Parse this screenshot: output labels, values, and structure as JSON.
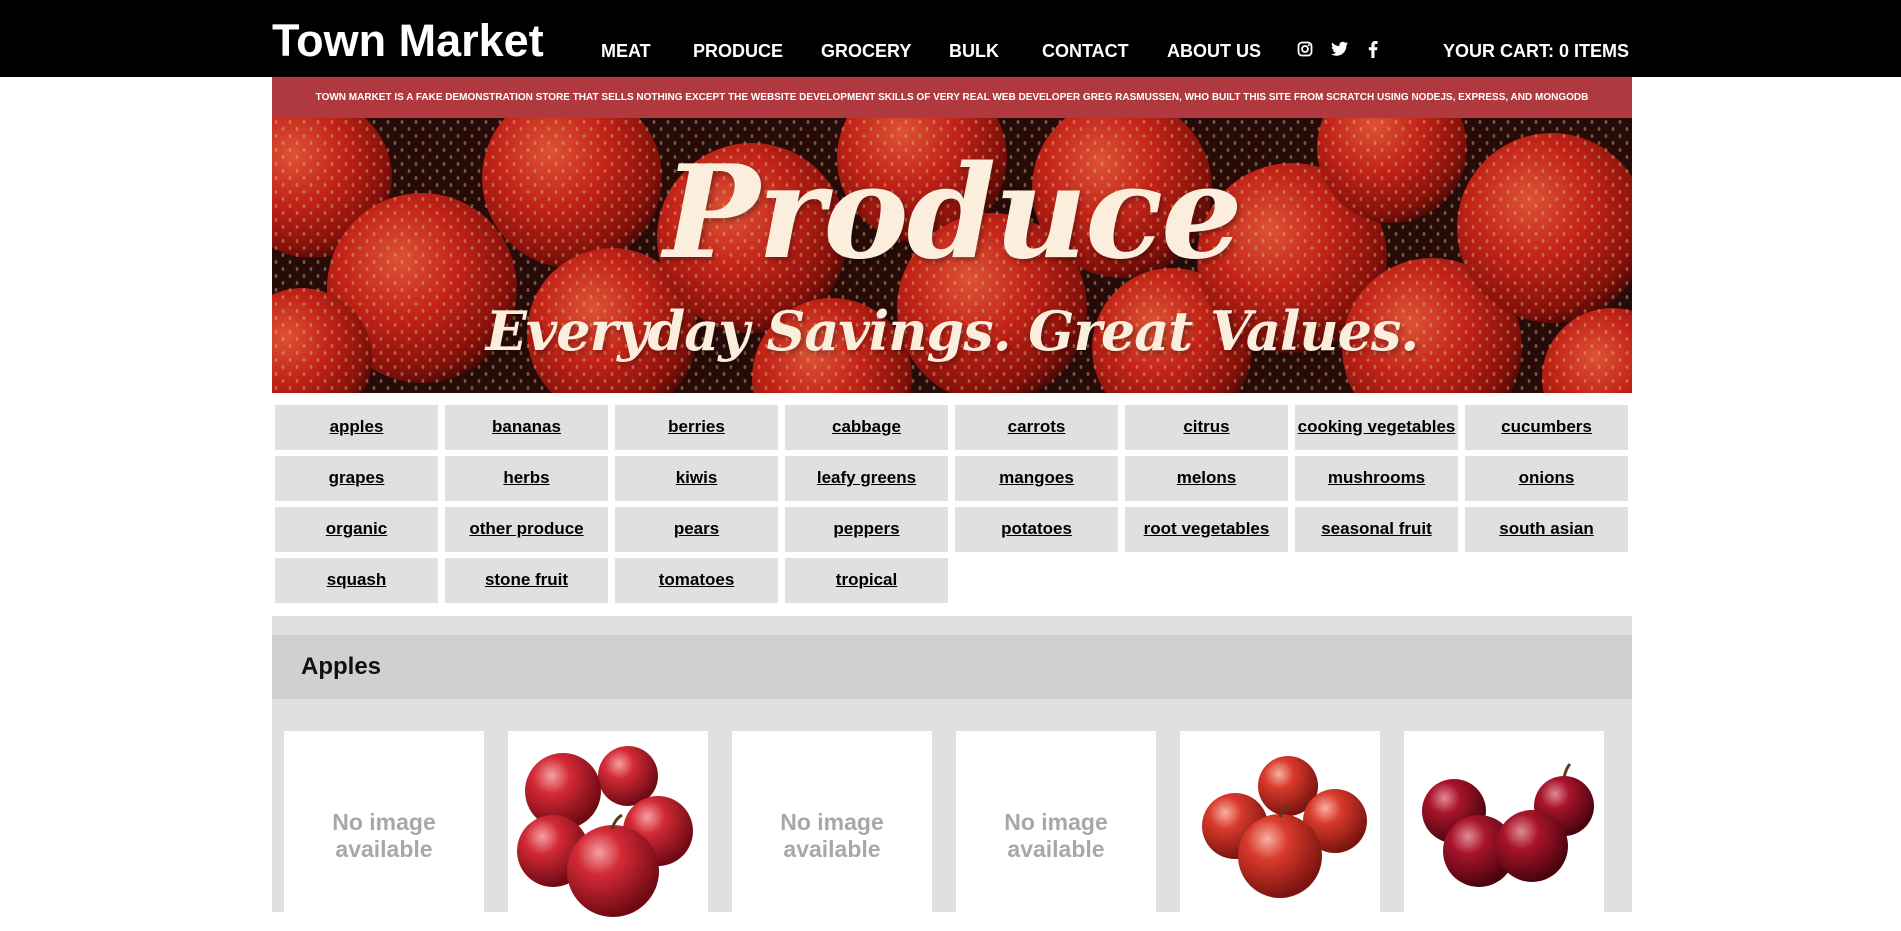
{
  "header": {
    "logo": "Town Market",
    "nav": [
      "MEAT",
      "PRODUCE",
      "GROCERY",
      "BULK",
      "CONTACT",
      "ABOUT US"
    ],
    "social_icons": [
      "instagram-icon",
      "twitter-icon",
      "facebook-icon"
    ],
    "cart": "YOUR CART: 0 ITEMS"
  },
  "notice": "TOWN MARKET IS A FAKE DEMONSTRATION STORE THAT SELLS NOTHING EXCEPT THE WEBSITE DEVELOPMENT SKILLS OF VERY REAL WEB DEVELOPER GREG RASMUSSEN, WHO BUILT THIS SITE FROM SCRATCH USING NODEJS, EXPRESS, AND MONGODB",
  "hero": {
    "title": "Produce",
    "subtitle": "Everyday Savings. Great Values."
  },
  "categories": [
    "apples",
    "bananas",
    "berries",
    "cabbage",
    "carrots",
    "citrus",
    "cooking vegetables",
    "cucumbers",
    "grapes",
    "herbs",
    "kiwis",
    "leafy greens",
    "mangoes",
    "melons",
    "mushrooms",
    "onions",
    "organic",
    "other produce",
    "pears",
    "peppers",
    "potatoes",
    "root vegetables",
    "seasonal fruit",
    "south asian",
    "squash",
    "stone fruit",
    "tomatoes",
    "tropical"
  ],
  "section": {
    "title": "Apples",
    "no_image_line1": "No image",
    "no_image_line2": "available",
    "products": [
      {
        "image": "none"
      },
      {
        "image": "apples-photo"
      },
      {
        "image": "none"
      },
      {
        "image": "none"
      },
      {
        "image": "apples-photo"
      },
      {
        "image": "apples-photo"
      }
    ]
  },
  "colors": {
    "topbar": "#000000",
    "notice": "#b0393f",
    "category_bg": "#e0e0e0",
    "section_bg": "#e0e0e0",
    "hero_text": "#fbeedc"
  }
}
